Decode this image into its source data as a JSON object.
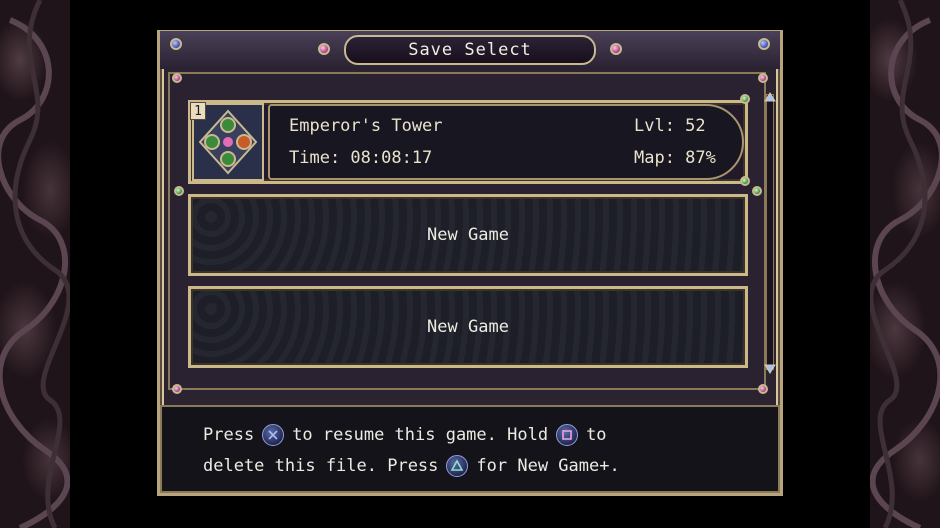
{
  "title": "Save Select",
  "slots": [
    {
      "number": "1",
      "location": "Emperor's Tower",
      "time": "Time: 08:08:17",
      "level": "Lvl: 52",
      "map": "Map: 87%"
    },
    {
      "label": "New Game"
    },
    {
      "label": "New Game"
    }
  ],
  "help": {
    "line1_a": "Press",
    "line1_b": "to resume this game. Hold",
    "line1_c": "to",
    "line2_a": "delete this file. Press",
    "line2_b": "for New Game+."
  },
  "icons": {
    "cross": "cross-button-icon",
    "square": "square-button-icon",
    "triangle": "triangle-button-icon"
  },
  "colors": {
    "frame_gold": "#cbb98a",
    "panel_dark": "#2b2430",
    "text": "#ecebe2",
    "gem_blue": "#3a4aa8",
    "gem_pink": "#a83a7c",
    "gem_green": "#3a8a3a"
  }
}
